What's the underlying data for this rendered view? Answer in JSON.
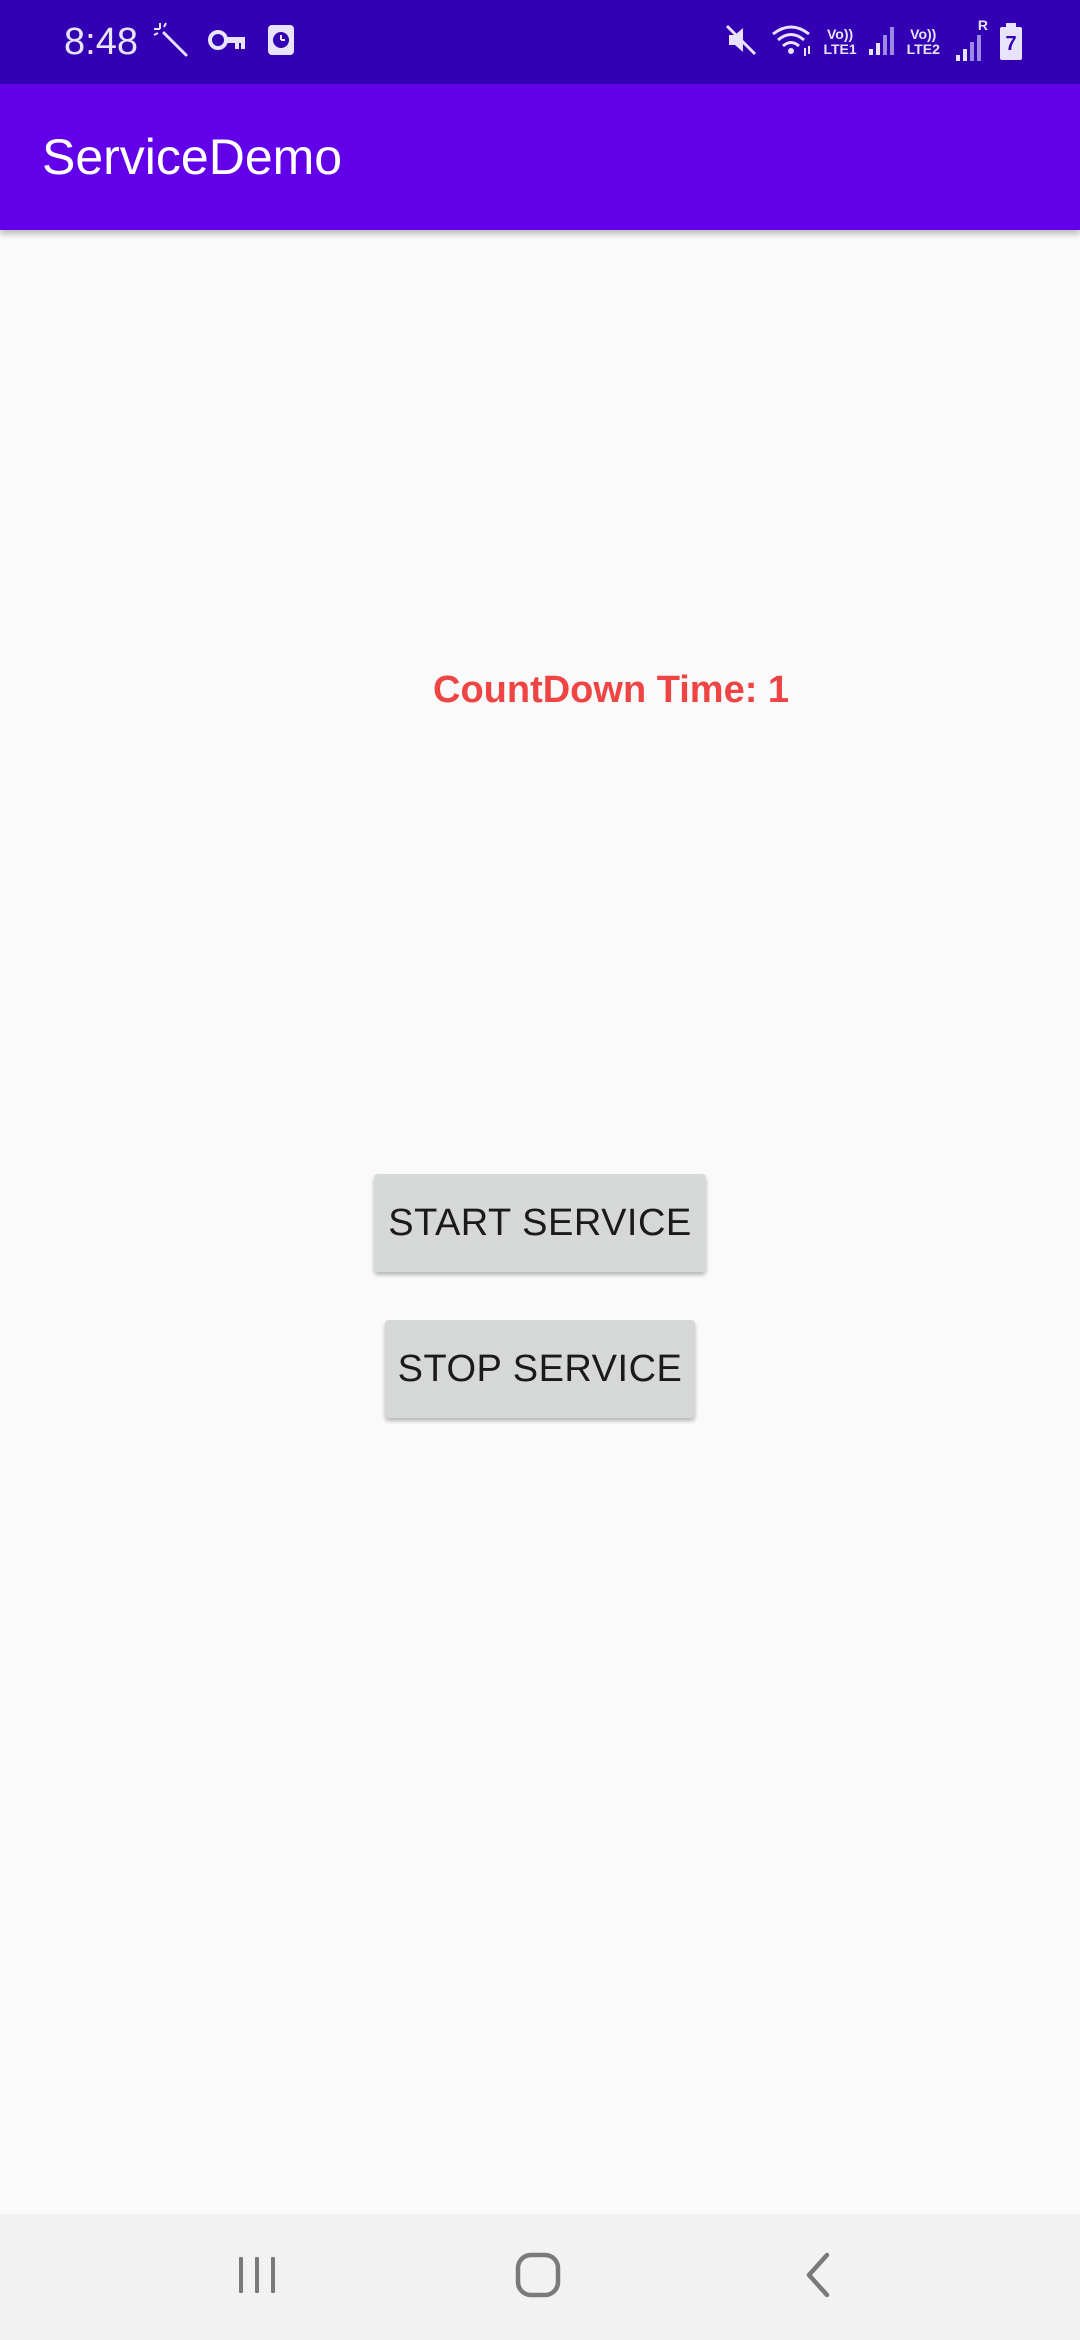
{
  "status_bar": {
    "time": "8:48",
    "icons_left": [
      "magic-wand-icon",
      "key-icon",
      "clock-badge-icon"
    ],
    "icons_right": [
      "mute-icon",
      "wifi-icon",
      "signal-sim1-icon",
      "signal-sim2-icon",
      "battery-charging-icon"
    ],
    "sim1_label_top": "Vo))",
    "sim1_label_bottom": "LTE1",
    "sim2_label_top": "Vo))",
    "sim2_label_bottom": "LTE2",
    "roaming_mark": "R",
    "battery_level": "7"
  },
  "app_bar": {
    "title": "ServiceDemo",
    "color": "#6200ea"
  },
  "content": {
    "countdown_text": "CountDown Time: 1",
    "countdown_color": "#ee4444"
  },
  "buttons": {
    "start_label": "START SERVICE",
    "stop_label": "STOP SERVICE"
  },
  "nav_bar": {
    "items": [
      "recents-icon",
      "home-icon",
      "back-icon"
    ]
  }
}
